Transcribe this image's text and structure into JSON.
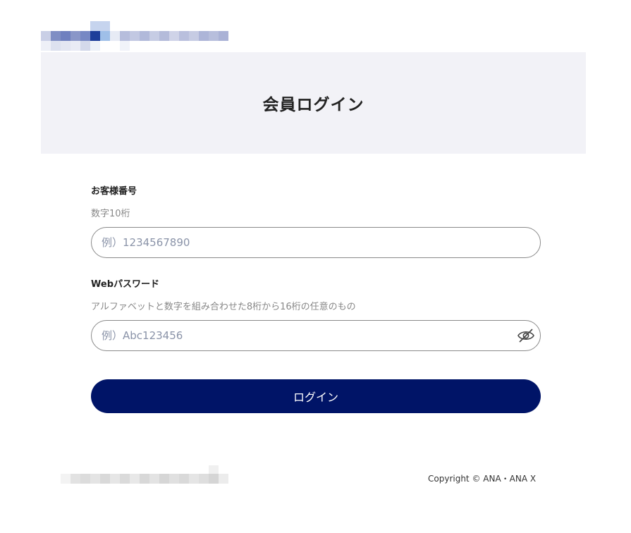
{
  "header": {
    "title": "会員ログイン"
  },
  "customer_number": {
    "label": "お客様番号",
    "hint": "数字10桁",
    "placeholder": "例）1234567890",
    "value": ""
  },
  "password": {
    "label": "Webパスワード",
    "hint": "アルファベットと数字を組み合わせた8桁から16桁の任意のもの",
    "placeholder": "例）Abc123456",
    "value": "",
    "toggle_icon": "eye-slash-icon"
  },
  "login_button": {
    "label": "ログイン"
  },
  "footer": {
    "copyright": "Copyright © ANA・ANA X"
  },
  "colors": {
    "brand_navy": "#001467",
    "header_band": "#f2f2f7"
  }
}
